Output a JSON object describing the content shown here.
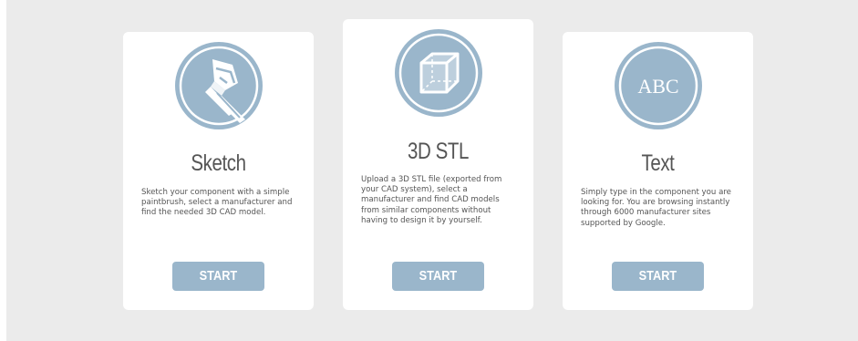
{
  "colors": {
    "background": "#ebebeb",
    "card": "#ffffff",
    "accent": "#9ab6cb",
    "text": "#555555"
  },
  "cards": [
    {
      "icon": "paintbrush-icon",
      "title": "Sketch",
      "description": "Sketch your component with a simple paintbrush, select a manufacturer and find the needed 3D CAD model.",
      "button_label": "START"
    },
    {
      "icon": "cube-icon",
      "title": "3D STL",
      "description": "Upload a 3D STL file (exported from your CAD system), select a manufacturer and find CAD models from similar components without having to design it by yourself.",
      "button_label": "START"
    },
    {
      "icon": "text-abc-icon",
      "icon_text": "ABC",
      "title": "Text",
      "description": "Simply type in the component you are looking for. You are browsing instantly through 6000 manufacturer sites supported by Google.",
      "button_label": "START"
    }
  ]
}
